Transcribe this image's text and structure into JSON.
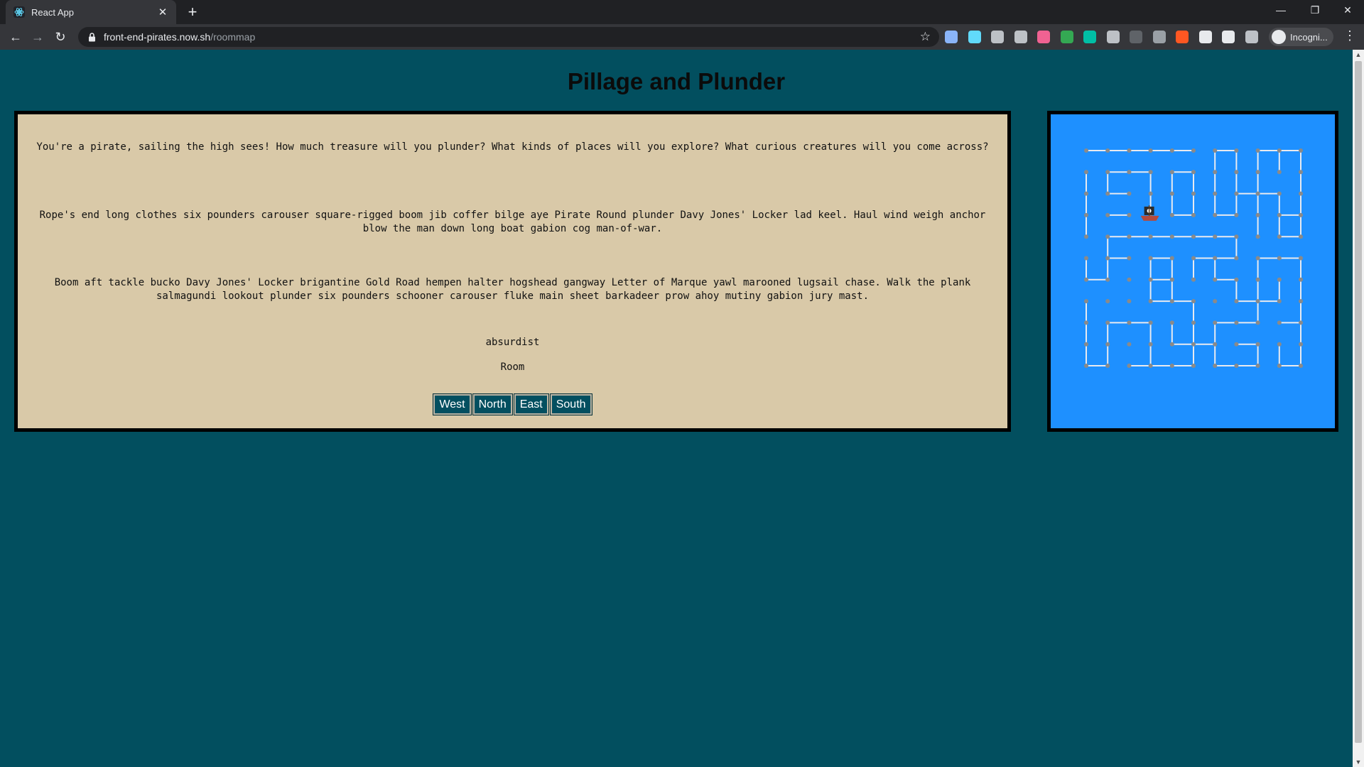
{
  "browser": {
    "tab_title": "React App",
    "tab_close": "✕",
    "new_tab": "+",
    "url_host": "front-end-pirates.now.sh",
    "url_path": "/roommap",
    "profile_label": "Incogni...",
    "window_controls": [
      "—",
      "❐",
      "✕"
    ],
    "extension_colors": [
      "#8ab4f8",
      "#61dafb",
      "#bdc1c6",
      "#bdc1c6",
      "#f06292",
      "#34a853",
      "#00bfa5",
      "#bdc1c6",
      "#5f6368",
      "#9aa0a6",
      "#ff5722",
      "#e8eaed",
      "#e8eaed",
      "#bdc1c6"
    ]
  },
  "page": {
    "title": "Pillage and Plunder"
  },
  "story": {
    "paragraphs": [
      "You're a pirate, sailing the high sees! How much treasure will you plunder? What kinds of places will you explore? What curious creatures will you come across?",
      "Rope's end long clothes six pounders carouser square-rigged boom jib coffer bilge aye Pirate Round plunder Davy Jones' Locker lad keel. Haul wind weigh anchor blow the man down long boat gabion cog man-of-war.",
      "Boom aft tackle bucko Davy Jones' Locker brigantine Gold Road hempen halter hogshead gangway Letter of Marque yawl marooned lugsail chase. Walk the plank salmagundi lookout plunder six pounders schooner carouser fluke main sheet barkadeer prow ahoy mutiny gabion jury mast."
    ],
    "player_name": "absurdist",
    "room_label": "Room",
    "buttons": [
      "West",
      "North",
      "East",
      "South"
    ]
  },
  "map": {
    "background": "#1e90ff",
    "node_color": "#8a8a8a",
    "wall_color": "#e8eaf0",
    "ship_icon": "pirate-ship-icon"
  }
}
